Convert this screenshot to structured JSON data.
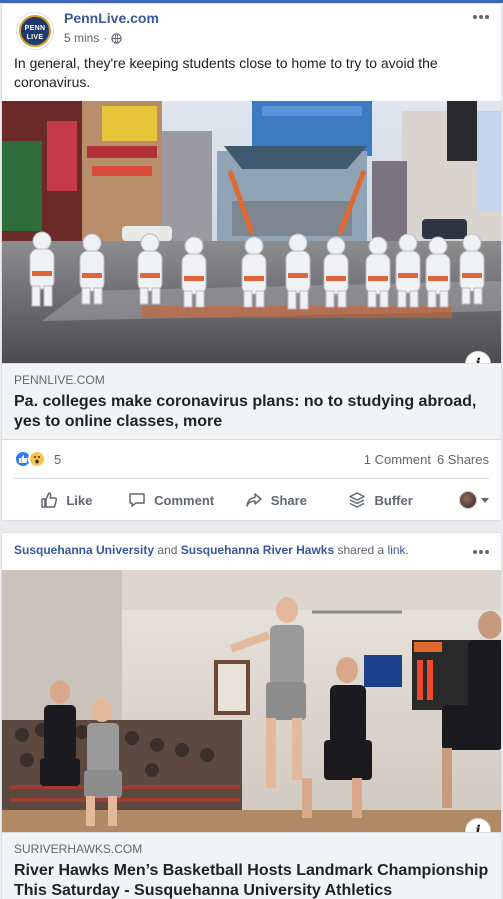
{
  "post1": {
    "page_name": "PennLive.com",
    "avatar_text": "PENN LIVE",
    "time": "5 mins",
    "privacy_icon": "globe-icon",
    "text": "In general, they're keeping students close to home to try to avoid the coronavirus.",
    "link": {
      "domain": "PENNLIVE.COM",
      "title": "Pa. colleges make coronavirus plans: no to studying abroad, yes to online classes, more"
    },
    "reactions": {
      "icons": [
        "like-reaction-icon",
        "wow-reaction-icon"
      ],
      "count": "5"
    },
    "comments": "1 Comment",
    "shares": "6 Shares",
    "actions": {
      "like": "Like",
      "comment": "Comment",
      "share": "Share",
      "buffer": "Buffer"
    }
  },
  "post2": {
    "sharer1": "Susquehanna University",
    "and": "and",
    "sharer2": "Susquehanna River Hawks",
    "shared": "shared a",
    "link_word": "link.",
    "link": {
      "domain": "SURIVERHAWKS.COM",
      "title": "River Hawks Men’s Basketball Hosts Landmark Championship This Saturday - Susquehanna University Athletics"
    }
  },
  "colors": {
    "accent": "#385898",
    "topbar": "#4267b2",
    "like_blue": "#2f7cf6",
    "wow_yellow": "#f7c34b"
  }
}
